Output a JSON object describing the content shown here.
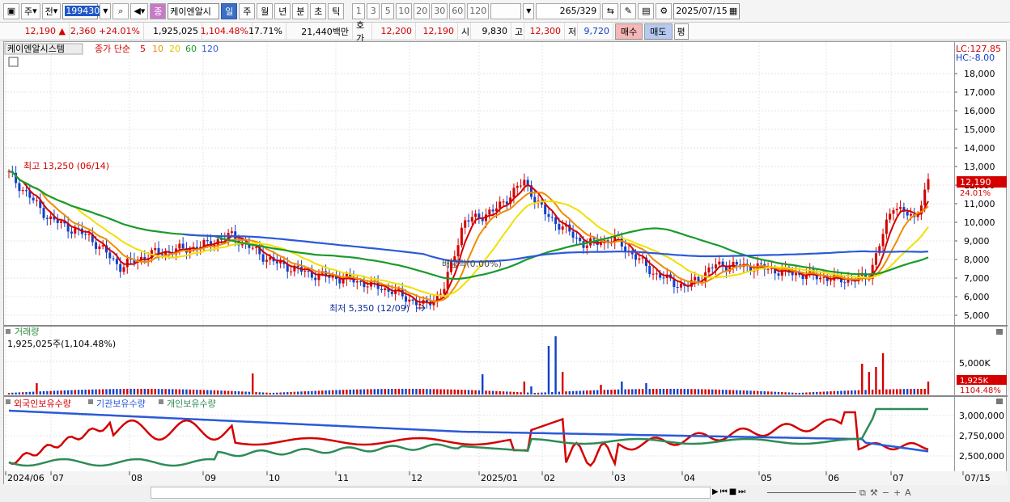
{
  "toolbar": {
    "market": "주",
    "period_type": "전",
    "stock_code": "199430",
    "stock_badge": "종",
    "stock_name": "케이엔알시",
    "period_tabs": [
      "일",
      "주",
      "월",
      "년",
      "분",
      "초",
      "틱"
    ],
    "active_tab": "일",
    "interval_buttons": [
      "1",
      "3",
      "5",
      "10",
      "20",
      "30",
      "60",
      "120"
    ],
    "count": "265",
    "total": "/329",
    "date": "2025/07/15"
  },
  "quote": {
    "price": "12,190",
    "arrow": "▲",
    "change": "2,360",
    "change_pct": "+24.01%",
    "volume": "1,925,025",
    "volume_pct": "1,104.48%",
    "turnover": "17.71%",
    "amount": "21,440백만",
    "ask_label": "호가",
    "ask": "12,200",
    "bid": "12,190",
    "open_label": "시",
    "open": "9,830",
    "high_label": "고",
    "high": "12,300",
    "low_label": "저",
    "low": "9,720",
    "buy_label": "매수",
    "sell_label": "매도",
    "eval_label": "평"
  },
  "price_panel": {
    "stock_label": "케이엔알시스템",
    "ma_title": "종가 단순",
    "ma_periods": [
      "5",
      "10",
      "20",
      "60",
      "120"
    ],
    "ma_colors": [
      "#d40000",
      "#f08c00",
      "#f0e000",
      "#1a9a2a",
      "#2a5ad8"
    ],
    "lc": "LC:127.85",
    "hc": "HC:-8.00",
    "y_ticks": [
      "18,000",
      "17,000",
      "16,000",
      "15,000",
      "14,000",
      "13,000",
      "12,000",
      "11,000",
      "10,000",
      "9,000",
      "8,000",
      "7,000",
      "6,000",
      "5,000"
    ],
    "current_price_tag": "12,190",
    "current_pct_tag": "24.01%",
    "high_annotation": "최고 13,250 (06/14)",
    "low_annotation": "최저 5,350 (12/09)",
    "dividend_annotation": "배당락(0.00%)"
  },
  "volume_panel": {
    "title": "거래량",
    "value": "1,925,025주(1,104.48%)",
    "y_tick": "5,000K",
    "current_tag": "1,925K",
    "current_pct": "1104.48%"
  },
  "holdings_panel": {
    "legend": [
      "외국인보유수량",
      "기관보유수량",
      "개인보유수량"
    ],
    "legend_colors": [
      "#d40000",
      "#2a5ad8",
      "#2e8b57"
    ],
    "y_ticks": [
      "3,000,000",
      "2,750,000",
      "2,500,000"
    ]
  },
  "x_axis": [
    "2024/06",
    "07",
    "08",
    "09",
    "10",
    "11",
    "12",
    "2025/01",
    "02",
    "03",
    "04",
    "05",
    "06",
    "07",
    "07/15"
  ]
}
